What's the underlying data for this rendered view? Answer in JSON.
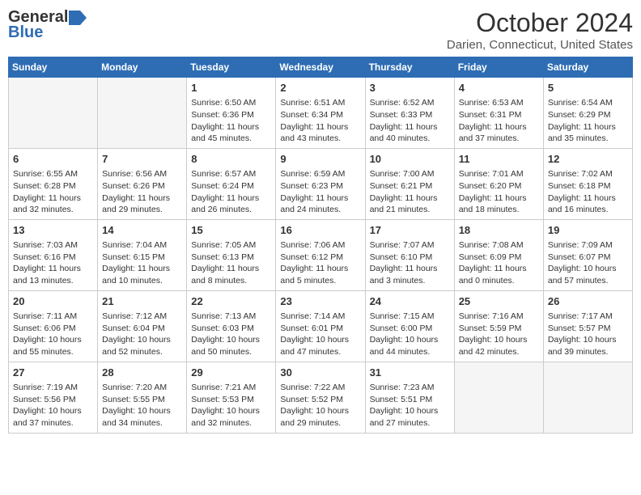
{
  "header": {
    "logo_general": "General",
    "logo_blue": "Blue",
    "title": "October 2024",
    "location": "Darien, Connecticut, United States"
  },
  "weekdays": [
    "Sunday",
    "Monday",
    "Tuesday",
    "Wednesday",
    "Thursday",
    "Friday",
    "Saturday"
  ],
  "weeks": [
    [
      {
        "day": "",
        "info": ""
      },
      {
        "day": "",
        "info": ""
      },
      {
        "day": "1",
        "info": "Sunrise: 6:50 AM\nSunset: 6:36 PM\nDaylight: 11 hours and 45 minutes."
      },
      {
        "day": "2",
        "info": "Sunrise: 6:51 AM\nSunset: 6:34 PM\nDaylight: 11 hours and 43 minutes."
      },
      {
        "day": "3",
        "info": "Sunrise: 6:52 AM\nSunset: 6:33 PM\nDaylight: 11 hours and 40 minutes."
      },
      {
        "day": "4",
        "info": "Sunrise: 6:53 AM\nSunset: 6:31 PM\nDaylight: 11 hours and 37 minutes."
      },
      {
        "day": "5",
        "info": "Sunrise: 6:54 AM\nSunset: 6:29 PM\nDaylight: 11 hours and 35 minutes."
      }
    ],
    [
      {
        "day": "6",
        "info": "Sunrise: 6:55 AM\nSunset: 6:28 PM\nDaylight: 11 hours and 32 minutes."
      },
      {
        "day": "7",
        "info": "Sunrise: 6:56 AM\nSunset: 6:26 PM\nDaylight: 11 hours and 29 minutes."
      },
      {
        "day": "8",
        "info": "Sunrise: 6:57 AM\nSunset: 6:24 PM\nDaylight: 11 hours and 26 minutes."
      },
      {
        "day": "9",
        "info": "Sunrise: 6:59 AM\nSunset: 6:23 PM\nDaylight: 11 hours and 24 minutes."
      },
      {
        "day": "10",
        "info": "Sunrise: 7:00 AM\nSunset: 6:21 PM\nDaylight: 11 hours and 21 minutes."
      },
      {
        "day": "11",
        "info": "Sunrise: 7:01 AM\nSunset: 6:20 PM\nDaylight: 11 hours and 18 minutes."
      },
      {
        "day": "12",
        "info": "Sunrise: 7:02 AM\nSunset: 6:18 PM\nDaylight: 11 hours and 16 minutes."
      }
    ],
    [
      {
        "day": "13",
        "info": "Sunrise: 7:03 AM\nSunset: 6:16 PM\nDaylight: 11 hours and 13 minutes."
      },
      {
        "day": "14",
        "info": "Sunrise: 7:04 AM\nSunset: 6:15 PM\nDaylight: 11 hours and 10 minutes."
      },
      {
        "day": "15",
        "info": "Sunrise: 7:05 AM\nSunset: 6:13 PM\nDaylight: 11 hours and 8 minutes."
      },
      {
        "day": "16",
        "info": "Sunrise: 7:06 AM\nSunset: 6:12 PM\nDaylight: 11 hours and 5 minutes."
      },
      {
        "day": "17",
        "info": "Sunrise: 7:07 AM\nSunset: 6:10 PM\nDaylight: 11 hours and 3 minutes."
      },
      {
        "day": "18",
        "info": "Sunrise: 7:08 AM\nSunset: 6:09 PM\nDaylight: 11 hours and 0 minutes."
      },
      {
        "day": "19",
        "info": "Sunrise: 7:09 AM\nSunset: 6:07 PM\nDaylight: 10 hours and 57 minutes."
      }
    ],
    [
      {
        "day": "20",
        "info": "Sunrise: 7:11 AM\nSunset: 6:06 PM\nDaylight: 10 hours and 55 minutes."
      },
      {
        "day": "21",
        "info": "Sunrise: 7:12 AM\nSunset: 6:04 PM\nDaylight: 10 hours and 52 minutes."
      },
      {
        "day": "22",
        "info": "Sunrise: 7:13 AM\nSunset: 6:03 PM\nDaylight: 10 hours and 50 minutes."
      },
      {
        "day": "23",
        "info": "Sunrise: 7:14 AM\nSunset: 6:01 PM\nDaylight: 10 hours and 47 minutes."
      },
      {
        "day": "24",
        "info": "Sunrise: 7:15 AM\nSunset: 6:00 PM\nDaylight: 10 hours and 44 minutes."
      },
      {
        "day": "25",
        "info": "Sunrise: 7:16 AM\nSunset: 5:59 PM\nDaylight: 10 hours and 42 minutes."
      },
      {
        "day": "26",
        "info": "Sunrise: 7:17 AM\nSunset: 5:57 PM\nDaylight: 10 hours and 39 minutes."
      }
    ],
    [
      {
        "day": "27",
        "info": "Sunrise: 7:19 AM\nSunset: 5:56 PM\nDaylight: 10 hours and 37 minutes."
      },
      {
        "day": "28",
        "info": "Sunrise: 7:20 AM\nSunset: 5:55 PM\nDaylight: 10 hours and 34 minutes."
      },
      {
        "day": "29",
        "info": "Sunrise: 7:21 AM\nSunset: 5:53 PM\nDaylight: 10 hours and 32 minutes."
      },
      {
        "day": "30",
        "info": "Sunrise: 7:22 AM\nSunset: 5:52 PM\nDaylight: 10 hours and 29 minutes."
      },
      {
        "day": "31",
        "info": "Sunrise: 7:23 AM\nSunset: 5:51 PM\nDaylight: 10 hours and 27 minutes."
      },
      {
        "day": "",
        "info": ""
      },
      {
        "day": "",
        "info": ""
      }
    ]
  ]
}
